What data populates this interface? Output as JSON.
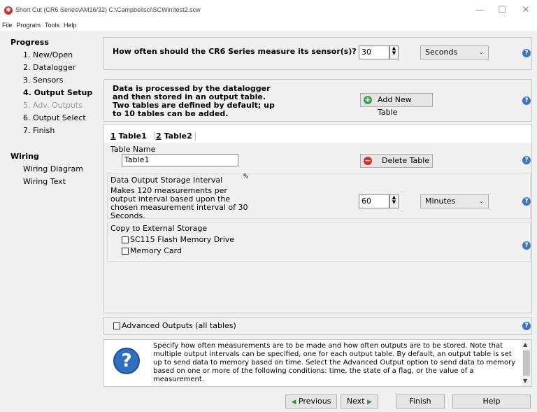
{
  "window": {
    "title": "Short Cut (CR6 Series\\AM16/32) C:\\Campbellsci\\SCWin\\test2.scw",
    "minimize": "—",
    "maximize": "☐",
    "close": "✕"
  },
  "menu": [
    "File",
    "Program",
    "Tools",
    "Help"
  ],
  "sidebar": {
    "progress_heading": "Progress",
    "progress_items": [
      "1. New/Open",
      "2. Datalogger",
      "3. Sensors",
      "4. Output Setup",
      "5. Adv. Outputs",
      "6. Output Select",
      "7. Finish"
    ],
    "wiring_heading": "Wiring",
    "wiring_items": [
      "Wiring Diagram",
      "Wiring Text"
    ]
  },
  "measure": {
    "question": "How often should the CR6 Series measure its sensor(s)?",
    "value": "30",
    "unit": "Seconds"
  },
  "tables_info": {
    "text": "Data is processed by the datalogger and then stored in an output table. Two tables are defined by default; up to 10 tables can be added.",
    "add_button": "Add New Table"
  },
  "tabs": [
    {
      "num": "1",
      "label": "Table1"
    },
    {
      "num": "2",
      "label": "Table2"
    }
  ],
  "table_name": {
    "label": "Table Name",
    "value": "Table1",
    "delete_button": "Delete Table"
  },
  "interval": {
    "label": "Data Output Storage Interval",
    "text": "Makes 120 measurements per output interval based upon the chosen measurement interval of 30 Seconds.",
    "value": "60",
    "unit": "Minutes"
  },
  "storage": {
    "label": "Copy to External Storage",
    "option1": "SC115 Flash Memory Drive",
    "option2": "Memory Card"
  },
  "advanced": "Advanced Outputs (all tables)",
  "help_text": "Specify how often measurements are to be made and how often outputs are to be stored. Note that multiple output intervals can be specified, one for each output table. By default, an output table is set up to send data to memory based on time. Select the Advanced Output option to send data to memory based on one or more of the following conditions: time, the state of a flag, or the value of a measurement.",
  "nav": {
    "previous": "Previous",
    "next": "Next",
    "finish": "Finish",
    "help": "Help"
  },
  "colors": {
    "accent_blue": "#3c74c8",
    "add_green": "#3aa64a",
    "delete_red": "#d0302a",
    "disabled_gray": "#9a9a9a"
  }
}
